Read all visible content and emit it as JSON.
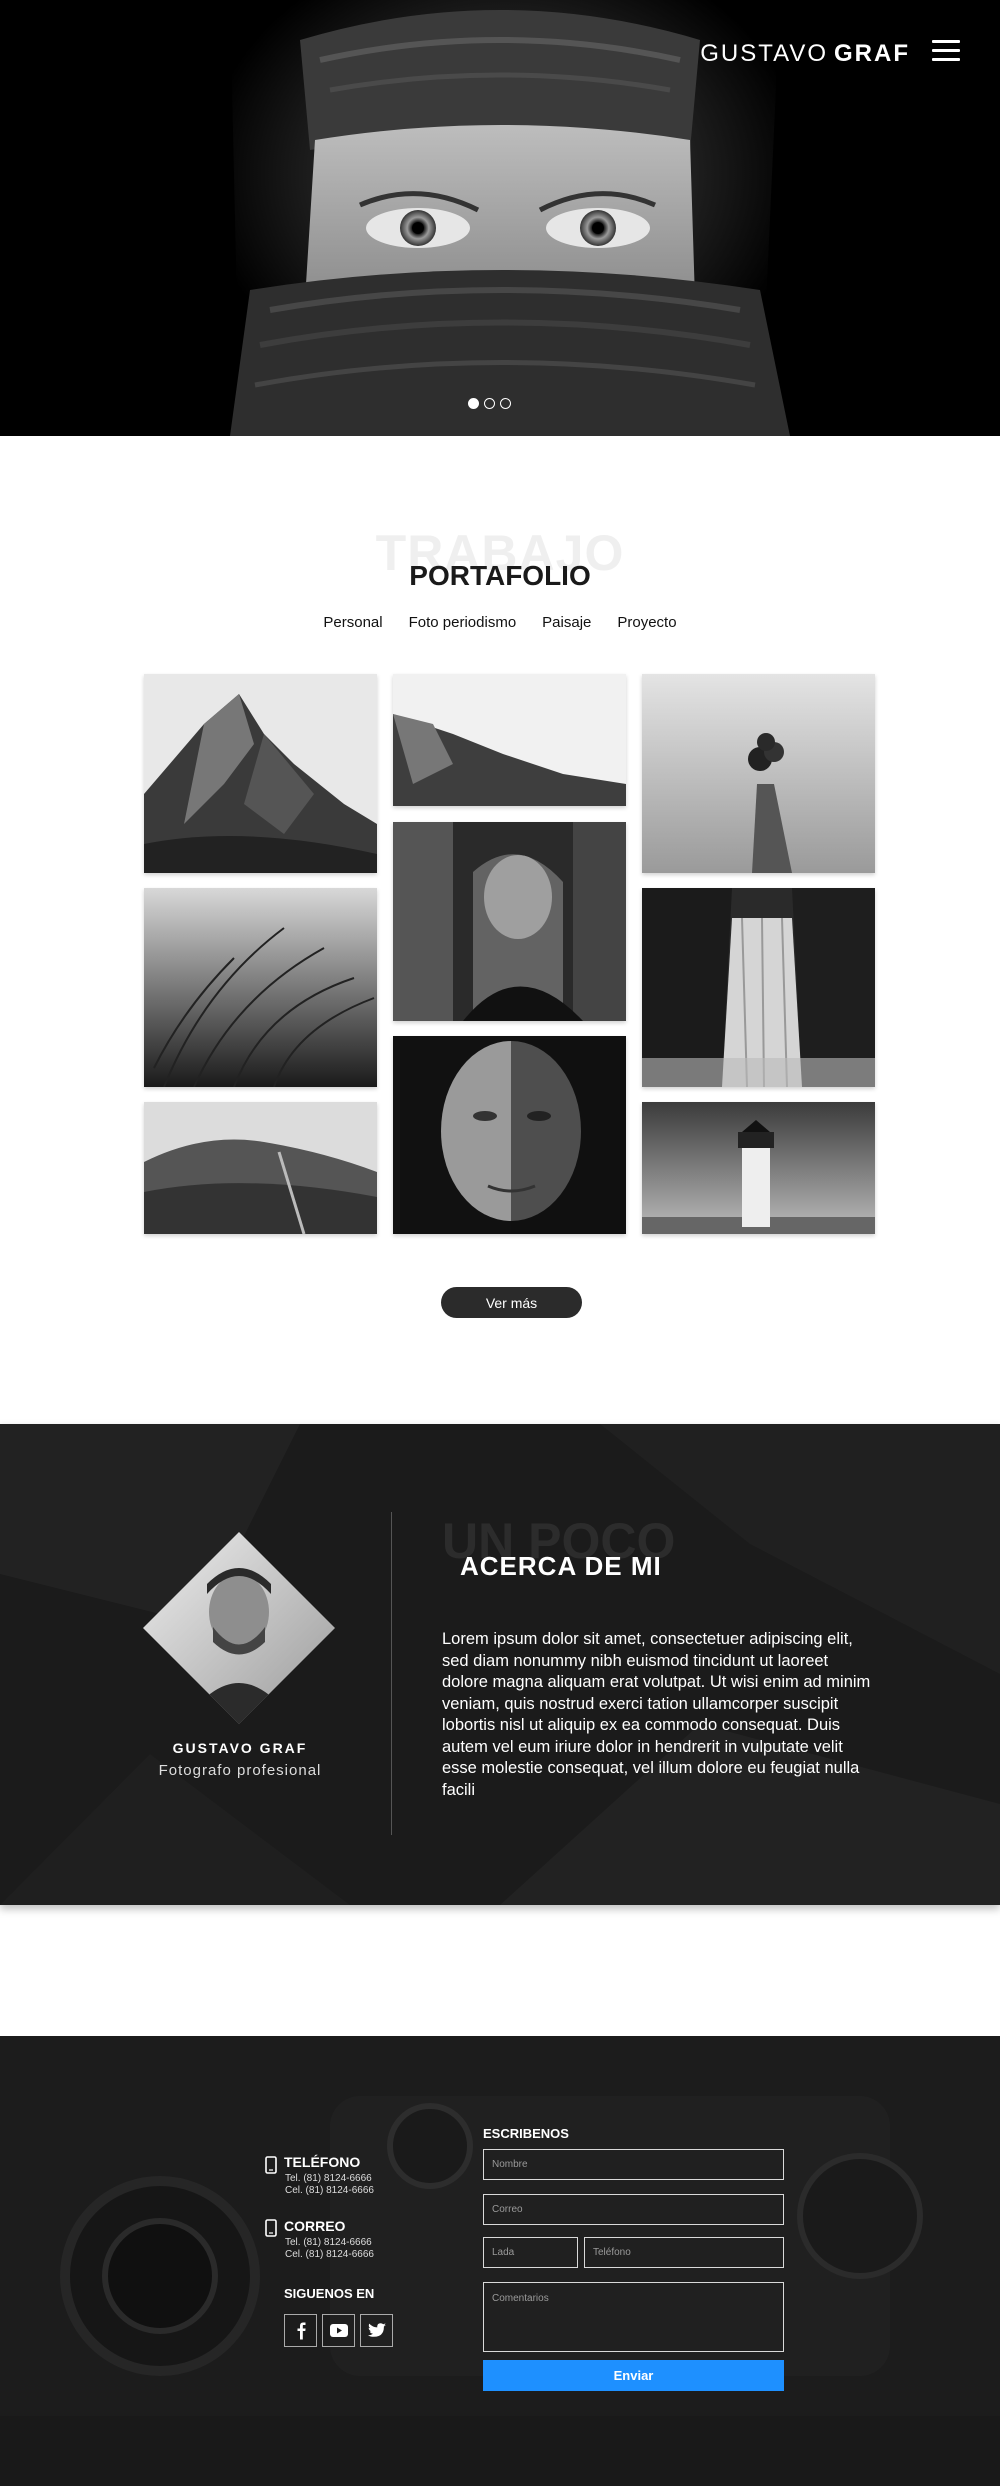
{
  "header": {
    "logo_light": "GUSTAVO",
    "logo_bold": "GRAF",
    "menu_icon": "hamburger-menu-icon",
    "slides": 3,
    "active_slide": 1
  },
  "portfolio": {
    "ghost_title": "TRABAJO",
    "title": "PORTAFOLIO",
    "filters": [
      "Personal",
      "Foto periodismo",
      "Paisaje",
      "Proyecto"
    ],
    "more_button": "Ver más"
  },
  "about": {
    "ghost_title": "UN POCO",
    "title": "ACERCA DE  MI",
    "name": "GUSTAVO GRAF",
    "role": "Fotografo profesional",
    "text": "Lorem ipsum dolor sit amet, consectetuer adipiscing elit, sed diam nonummy nibh euismod tincidunt ut laoreet dolore magna aliquam erat volutpat. Ut wisi enim ad minim veniam, quis nostrud exerci tation ullamcorper suscipit lobortis nisl ut aliquip ex ea commodo consequat. Duis autem vel eum iriure dolor in hendrerit in vulputate velit esse molestie consequat, vel illum dolore eu feugiat nulla facili"
  },
  "contact": {
    "phone_title": "TELÉFONO",
    "phone_tel": "Tel. (81) 8124-6666",
    "phone_cel": "Cel. (81) 8124-6666",
    "mail_title": "CORREO",
    "mail_tel": "Tel. (81) 8124-6666",
    "mail_cel": "Cel. (81) 8124-6666",
    "social_title": "SIGUENOS EN",
    "social_icons": [
      "facebook-icon",
      "youtube-icon",
      "twitter-icon"
    ],
    "form_title": "ESCRIBENOS",
    "placeholders": {
      "name": "Nombre",
      "email": "Correo",
      "area": "Lada",
      "phone": "Teléfono",
      "comments": "Comentarios"
    },
    "send_button": "Enviar",
    "accent": "#1e90ff"
  }
}
